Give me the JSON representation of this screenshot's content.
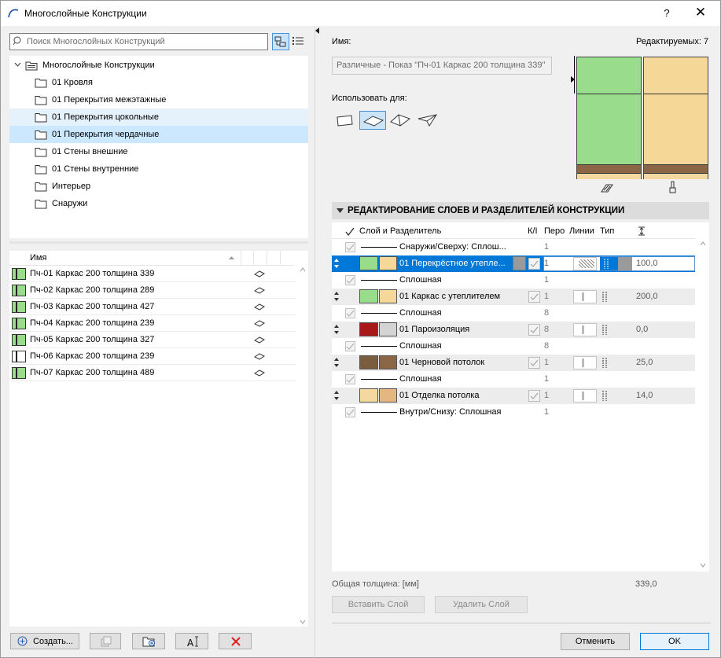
{
  "window": {
    "title": "Многослойные Конструкции",
    "help": "?",
    "close": "✕"
  },
  "search": {
    "placeholder": "Поиск Многослойных Конструкций"
  },
  "tree": {
    "root": "Многослойные Конструкции",
    "folders": [
      "01 Кровля",
      "01 Перекрытия межэтажные",
      "01 Перекрытия цокольные",
      "01 Перекрытия чердачные",
      "01 Стены внешние",
      "01 Стены внутренние",
      "Интерьер",
      "Снаружи"
    ]
  },
  "list": {
    "header": "Имя",
    "items": [
      {
        "name": "Пч-01 Каркас 200 толщина 339",
        "c": "#98dc8c"
      },
      {
        "name": "Пч-02 Каркас 200 толщина 289",
        "c": "#98dc8c"
      },
      {
        "name": "Пч-03 Каркас 200 толщина 427",
        "c": "#98dc8c"
      },
      {
        "name": "Пч-04 Каркас 200 толщина 239",
        "c": "#98dc8c"
      },
      {
        "name": "Пч-05 Каркас 200 толщина 327",
        "c": "#98dc8c"
      },
      {
        "name": "Пч-06 Каркас 200 толщина 239",
        "c": "#ffffff"
      },
      {
        "name": "Пч-07 Каркас 200 толщина 489",
        "c": "#98dc8c"
      }
    ]
  },
  "buttons": {
    "create": "Создать...",
    "insert_layer": "Вставить Слой",
    "delete_layer": "Удалить Слой",
    "cancel": "Отменить",
    "ok": "OK"
  },
  "props": {
    "name_label": "Имя:",
    "editable": "Редактируемых: 7",
    "name_value": "Различные - Показ \"Пч-01 Каркас 200 толщина 339\"",
    "use_for": "Использовать для:"
  },
  "section": {
    "title": "РЕДАКТИРОВАНИЕ СЛОЕВ И РАЗДЕЛИТЕЛЕЙ КОНСТРУКЦИИ"
  },
  "columns": {
    "layer": "Слой и Разделитель",
    "ki": "К/І",
    "pen": "Перо",
    "lines": "Линии",
    "type": "Тип"
  },
  "rows": [
    {
      "kind": "sep",
      "name": "Снаружи/Сверху: Сплош...",
      "pen": "1"
    },
    {
      "kind": "layer",
      "name": "01 Перекрёстное утепле...",
      "pen": "1",
      "thk": "100,0",
      "c1": "#98dc8c",
      "c2": "#f5d898",
      "sel": true
    },
    {
      "kind": "sep",
      "name": "Сплошная",
      "pen": "1"
    },
    {
      "kind": "layer",
      "name": "01 Каркас с утеплителем",
      "pen": "1",
      "thk": "200,0",
      "c1": "#98dc8c",
      "c2": "#f5d898"
    },
    {
      "kind": "sep",
      "name": "Сплошная",
      "pen": "8"
    },
    {
      "kind": "layer",
      "name": "01 Пароизоляция",
      "pen": "8",
      "thk": "0,0",
      "c1": "#a81818",
      "c2": "#d4d4d4"
    },
    {
      "kind": "sep",
      "name": "Сплошная",
      "pen": "8"
    },
    {
      "kind": "layer",
      "name": "01 Черновой потолок",
      "pen": "1",
      "thk": "25,0",
      "c1": "#7a5c3e",
      "c2": "#8a6646"
    },
    {
      "kind": "sep",
      "name": "Сплошная",
      "pen": "1"
    },
    {
      "kind": "layer",
      "name": "01 Отделка потолка",
      "pen": "1",
      "thk": "14,0",
      "c1": "#f5d8a0",
      "c2": "#e6b680"
    },
    {
      "kind": "sep",
      "name": "Внутри/Снизу: Сплошная",
      "pen": "1"
    }
  ],
  "summary": {
    "label": "Общая толщина: [мм]",
    "value": "339,0"
  },
  "colors": {
    "accent": "#0078d7",
    "green": "#98dc8c",
    "beige": "#f5d898"
  }
}
